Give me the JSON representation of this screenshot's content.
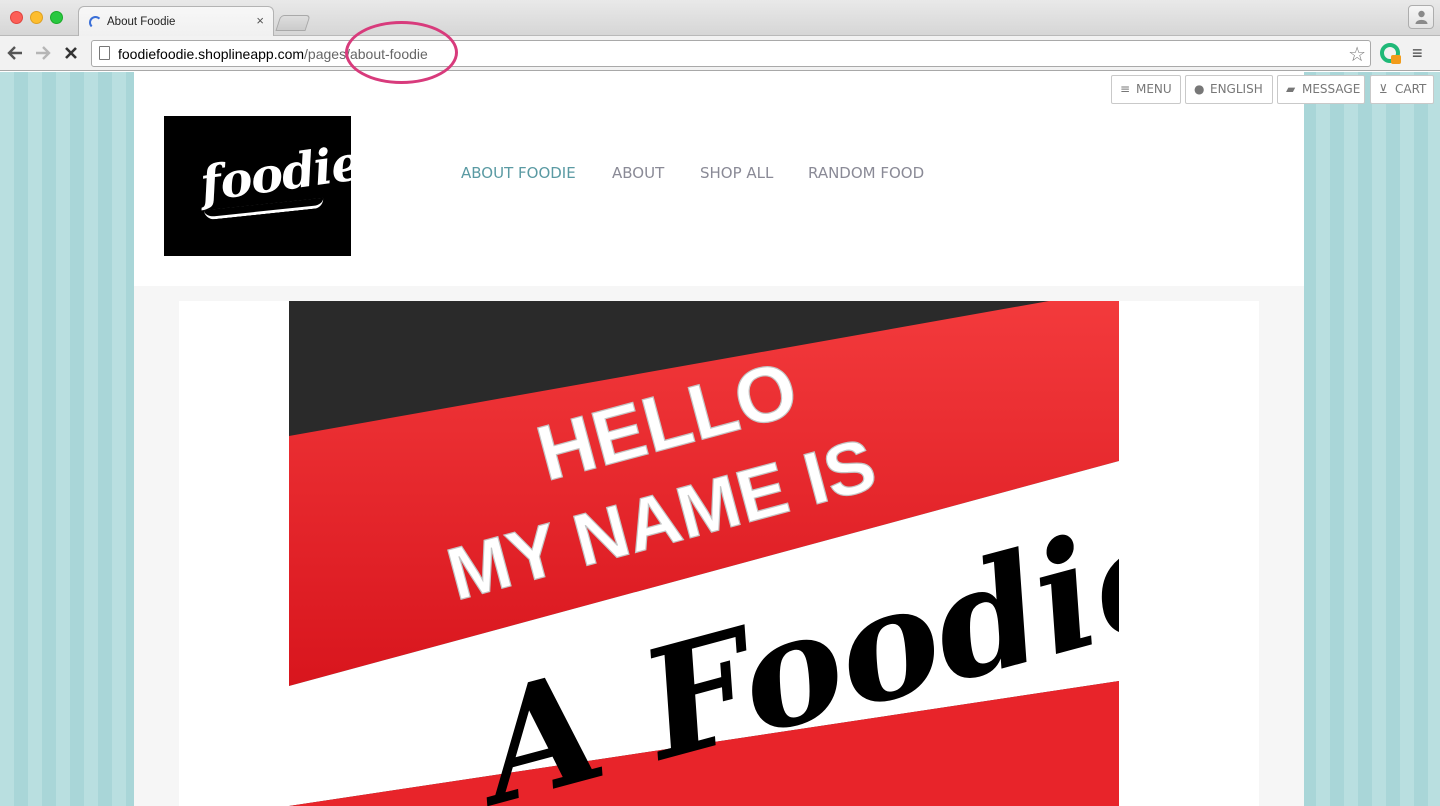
{
  "browser": {
    "tab_title": "About Foodie",
    "tab_close": "×",
    "url_host": "foodiefoodie.shoplineapp.com",
    "url_path": "/pages/about-foodie"
  },
  "utility_bar": {
    "menu": "MENU",
    "language": "ENGLISH",
    "message": "MESSAGE",
    "cart": "CART"
  },
  "logo_text": "foodie",
  "nav": [
    "ABOUT FOODIE",
    "ABOUT",
    "SHOP ALL",
    "RANDOM FOOD"
  ],
  "hero": {
    "line1": "HELLO",
    "line2": "MY NAME IS",
    "line3": "A Foodie"
  },
  "colors": {
    "accent": "#5a9aa3",
    "nav_text": "#8a8a96",
    "highlight": "#d83b7c",
    "tag_red": "#e8242a",
    "background_stripe": "#b9dfe0"
  },
  "icons": [
    "back-icon",
    "forward-icon",
    "stop-icon",
    "page-icon",
    "star-icon",
    "extension-icon",
    "chrome-menu-icon",
    "profile-icon",
    "menu-icon",
    "globe-icon",
    "chat-icon",
    "cart-icon"
  ]
}
